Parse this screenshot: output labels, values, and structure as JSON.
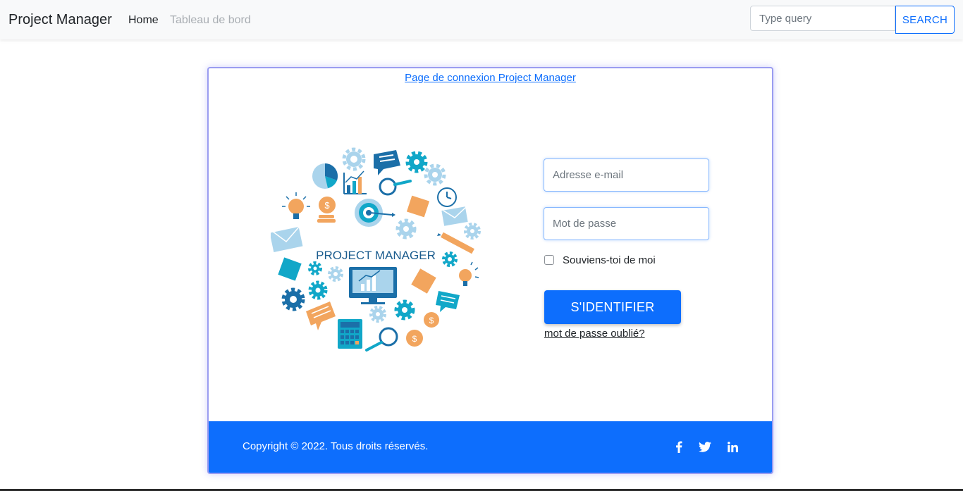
{
  "navbar": {
    "brand": "Project Manager",
    "links": [
      {
        "label": "Home"
      },
      {
        "label": "Tableau de bord"
      }
    ],
    "search": {
      "placeholder": "Type query",
      "value": "",
      "button_label": "SEARCH"
    }
  },
  "card": {
    "title": "Page de connexion Project Manager",
    "illustration_text": "PROJECT MANAGER",
    "form": {
      "email_placeholder": "Adresse e-mail",
      "password_placeholder": "Mot de passe",
      "remember_label": "Souviens-toi de moi",
      "remember_checked": false,
      "submit_label": "S'IDENTIFIER",
      "forgot_label": "mot de passe oublié?"
    },
    "footer": {
      "copyright": "Copyright © 2022. Tous droits réservés.",
      "social": [
        {
          "icon": "facebook-icon"
        },
        {
          "icon": "twitter-icon"
        },
        {
          "icon": "linkedin-icon"
        }
      ]
    }
  },
  "colors": {
    "primary": "#0d6efd",
    "navbar_bg": "#f8f9fa",
    "card_border": "#9a9cf0"
  }
}
